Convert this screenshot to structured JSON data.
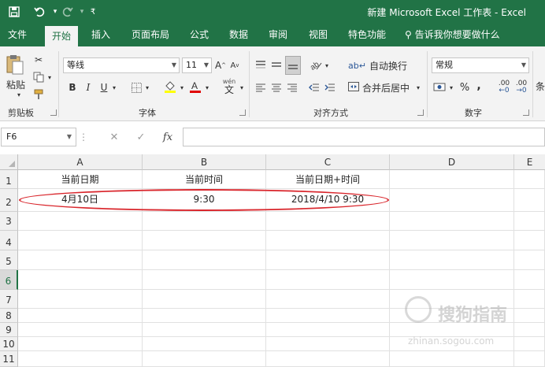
{
  "window": {
    "title": "新建 Microsoft Excel 工作表 - Excel"
  },
  "quick_access": {
    "save_icon": "save-icon",
    "undo_icon": "undo-icon",
    "redo_icon": "redo-icon",
    "customize_icon": "customize-icon"
  },
  "tabs": [
    {
      "label": "文件"
    },
    {
      "label": "开始"
    },
    {
      "label": "插入"
    },
    {
      "label": "页面布局"
    },
    {
      "label": "公式"
    },
    {
      "label": "数据"
    },
    {
      "label": "审阅"
    },
    {
      "label": "视图"
    },
    {
      "label": "特色功能"
    }
  ],
  "tell_me": "告诉我你想要做什么",
  "ribbon": {
    "clipboard": {
      "label": "剪贴板",
      "paste": "粘贴"
    },
    "font": {
      "label": "字体",
      "name": "等线",
      "size": "11",
      "bold": "B",
      "italic": "I",
      "underline": "U",
      "wen": "wén",
      "wen_char": "文"
    },
    "alignment": {
      "label": "对齐方式",
      "wrap": "自动换行",
      "merge": "合并后居中"
    },
    "number": {
      "label": "数字",
      "format": "常规",
      "percent": "%",
      "comma": ",",
      "inc": ".00",
      "dec": ".00"
    },
    "style_partial": "条"
  },
  "formula_bar": {
    "name_box": "F6",
    "fx": "fx",
    "formula": ""
  },
  "columns": [
    "A",
    "B",
    "C",
    "D",
    "E"
  ],
  "rows": [
    "1",
    "2",
    "3",
    "4",
    "5",
    "6",
    "7",
    "8",
    "9",
    "10",
    "11"
  ],
  "cells": {
    "A1": "当前日期",
    "B1": "当前时间",
    "C1": "当前日期+时间",
    "A2": "4月10日",
    "B2": "9:30",
    "C2": "2018/4/10 9:30"
  },
  "selected_row": "6",
  "watermark": {
    "brand": "搜狗指南",
    "url": "zhinan.sogou.com"
  },
  "colors": {
    "excel_green": "#217346",
    "highlight_oval": "#d9262c"
  }
}
